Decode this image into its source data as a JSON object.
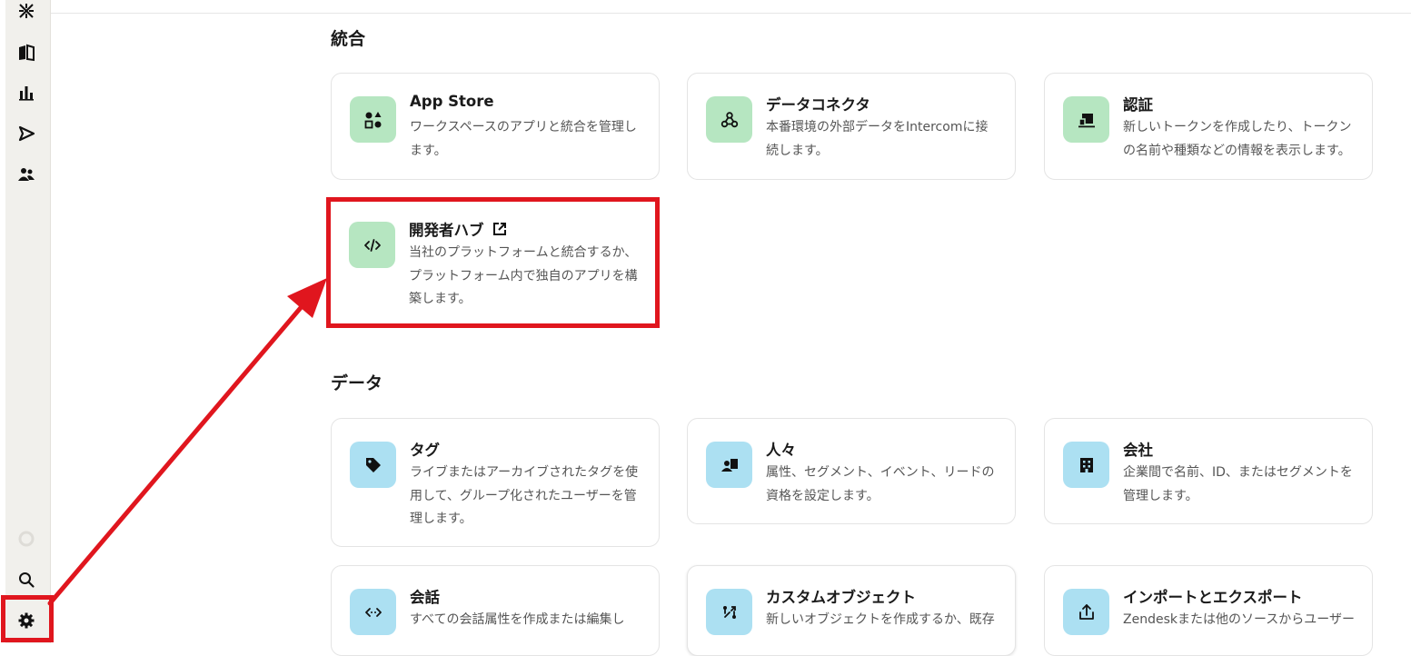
{
  "sections": {
    "integration": {
      "title": "統合"
    },
    "data": {
      "title": "データ"
    }
  },
  "cards": {
    "app_store": {
      "title": "App Store",
      "desc": "ワークスペースのアプリと統合を管理します。"
    },
    "data_connector": {
      "title": "データコネクタ",
      "desc": "本番環境の外部データをIntercomに接続します。"
    },
    "auth": {
      "title": "認証",
      "desc": "新しいトークンを作成したり、トークンの名前や種類などの情報を表示します。"
    },
    "dev_hub": {
      "title": "開発者ハブ",
      "desc": "当社のプラットフォームと統合するか、プラットフォーム内で独自のアプリを構築します。"
    },
    "tags": {
      "title": "タグ",
      "desc": "ライブまたはアーカイブされたタグを使用して、グループ化されたユーザーを管理します。"
    },
    "people": {
      "title": "人々",
      "desc": "属性、セグメント、イベント、リードの資格を設定します。"
    },
    "companies": {
      "title": "会社",
      "desc": "企業間で名前、ID、またはセグメントを管理します。"
    },
    "conversations": {
      "title": "会話",
      "desc": "すべての会話属性を作成または編集し"
    },
    "custom_objects": {
      "title": "カスタムオブジェクト",
      "desc": "新しいオブジェクトを作成するか、既存の"
    },
    "import_export": {
      "title": "インポートとエクスポート",
      "desc": "Zendeskまたは他のソースからユーザー"
    }
  },
  "sidebar": {
    "icons": [
      "logo-icon",
      "book-icon",
      "bar-chart-icon",
      "send-icon",
      "people-icon",
      "status-icon",
      "search-icon",
      "gear-icon"
    ]
  },
  "colors": {
    "accent_red": "#e0161e",
    "icon_green": "#b6e6c1",
    "icon_blue": "#ace0f2"
  }
}
